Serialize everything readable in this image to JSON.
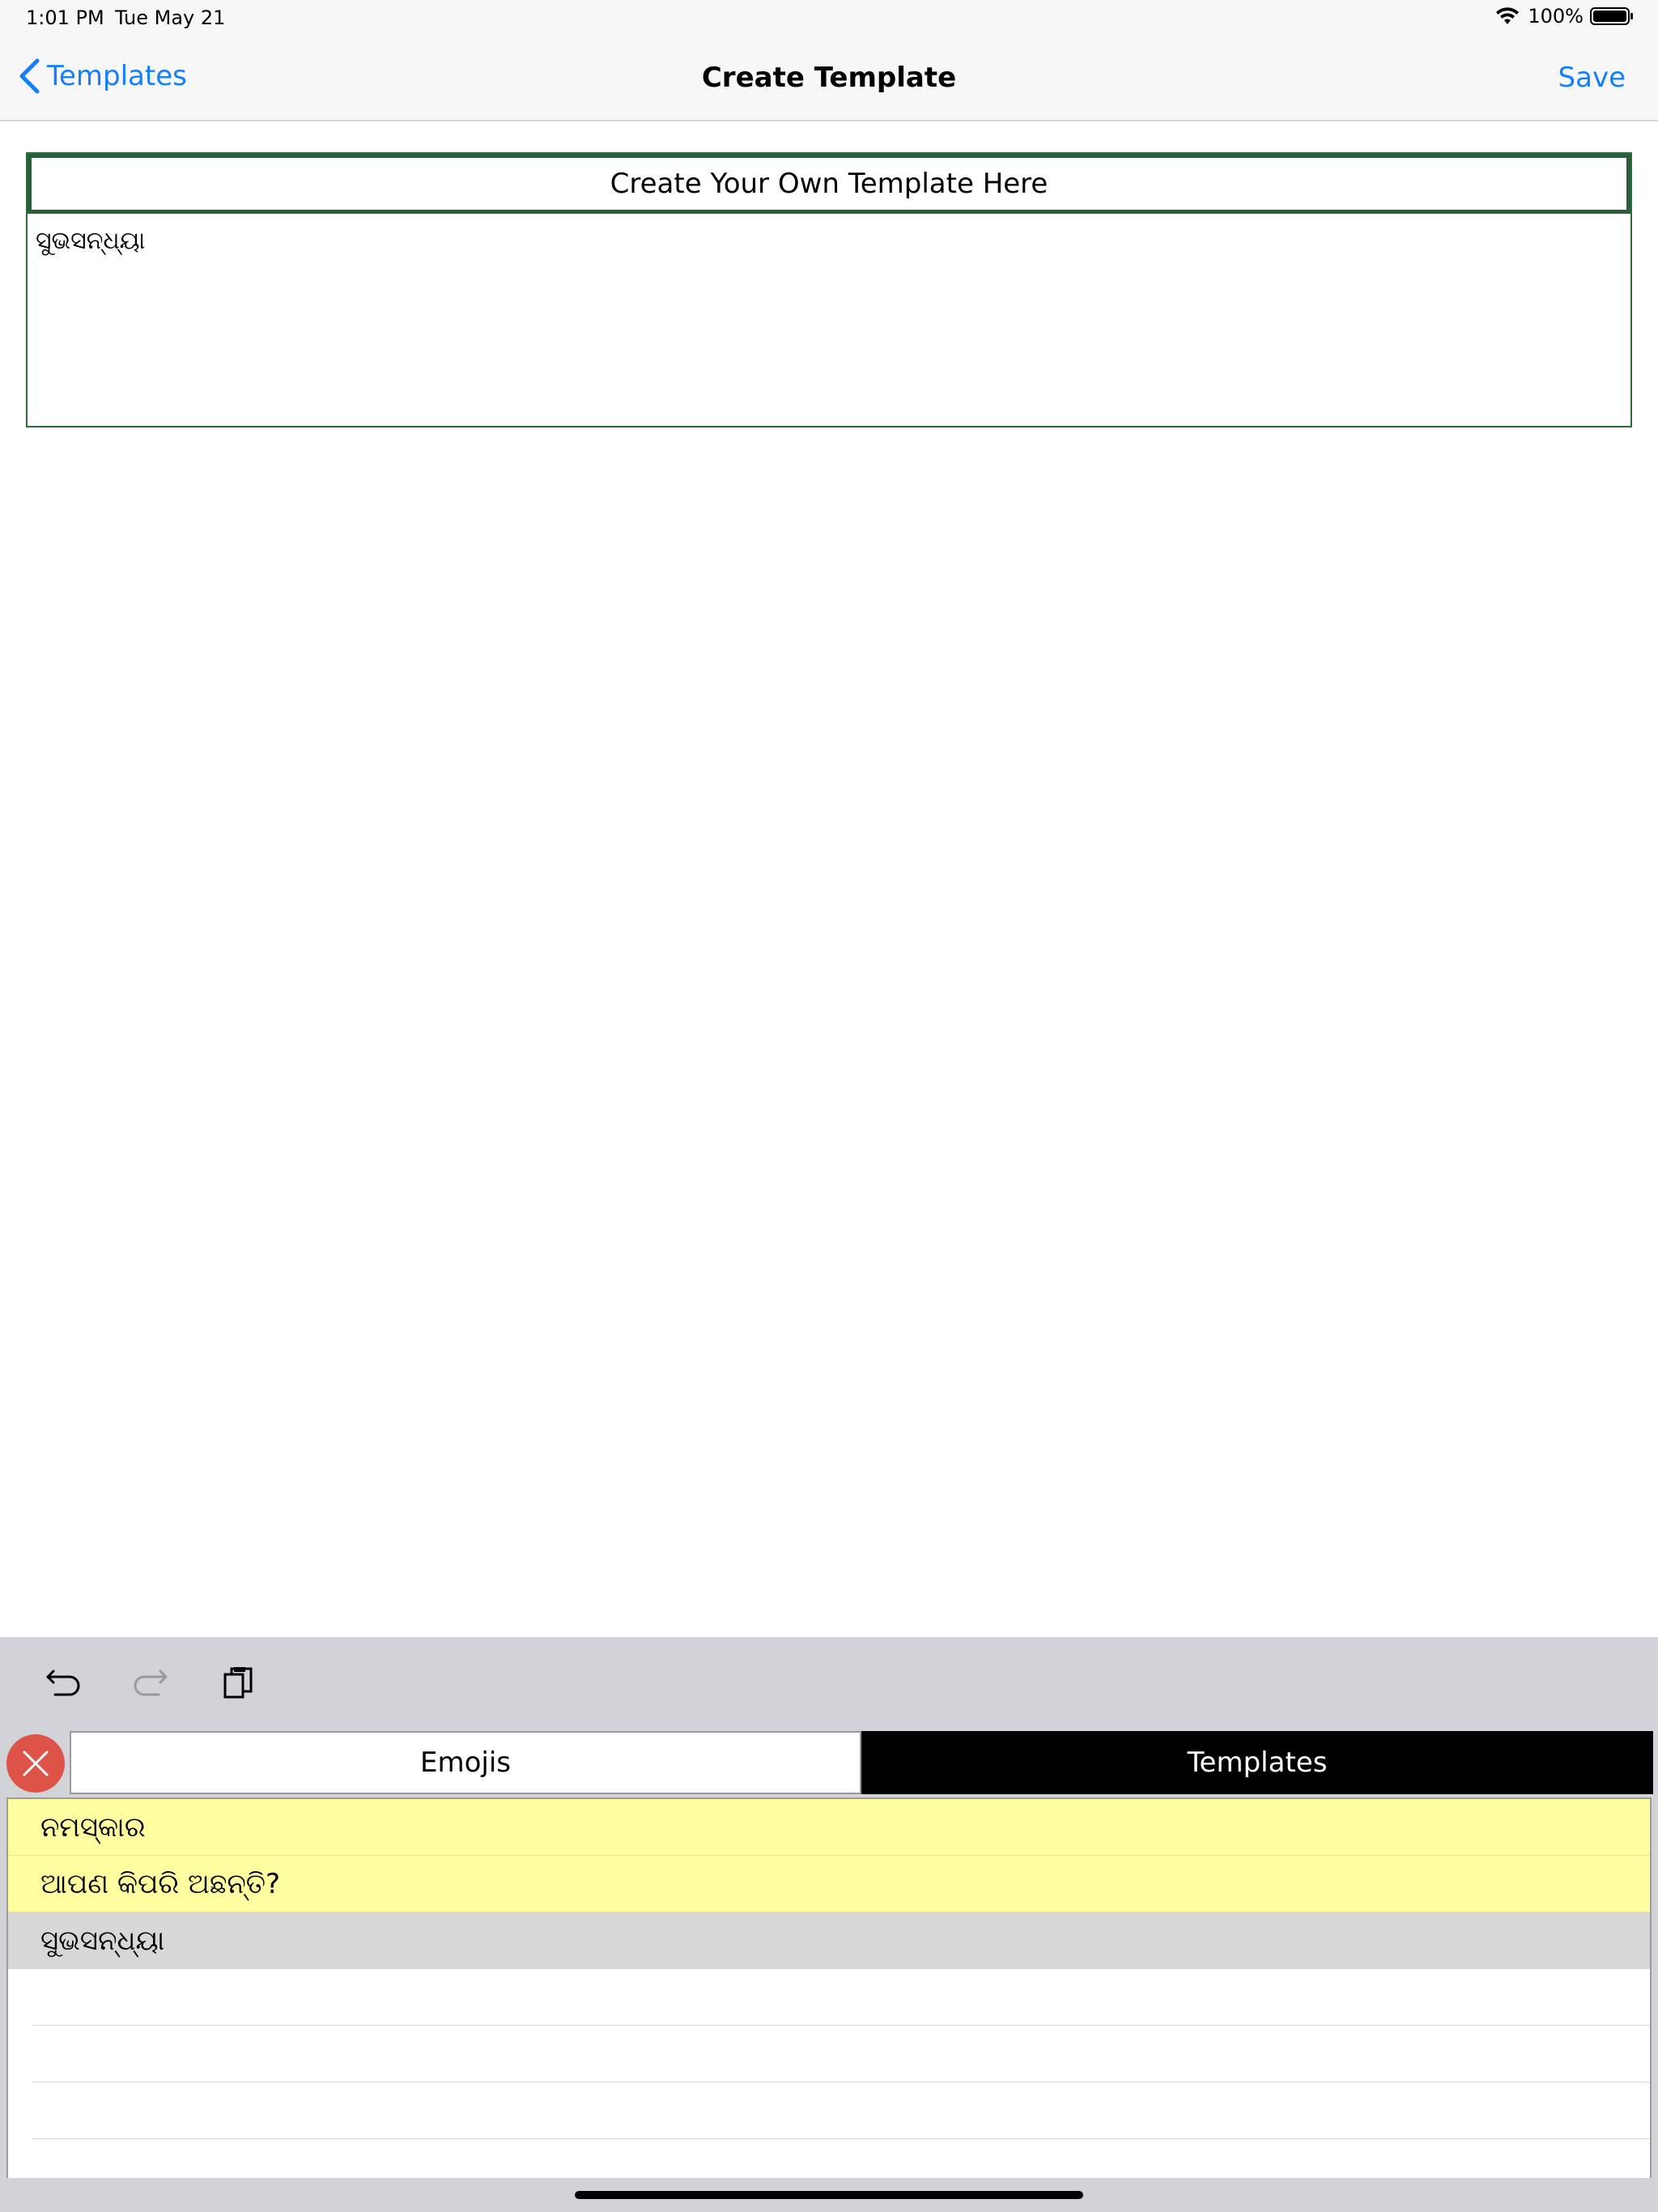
{
  "status_bar": {
    "time": "1:01 PM",
    "date": "Tue May 21",
    "battery": "100%"
  },
  "nav": {
    "back_label": "Templates",
    "title": "Create Template",
    "save_label": "Save"
  },
  "editor": {
    "header": "Create Your Own Template Here",
    "text": "ସୁଭସନ୍ଧ୍ୟା"
  },
  "toolbar": {
    "undo_icon": "undo-icon",
    "redo_icon": "redo-icon",
    "paste_icon": "paste-icon"
  },
  "keyboard": {
    "tabs": [
      {
        "label": "Emojis",
        "selected": false
      },
      {
        "label": "Templates",
        "selected": true
      }
    ],
    "templates": [
      {
        "text": "ନମସ୍କାର",
        "state": "highlighted"
      },
      {
        "text": "ଆପଣ କିପରି ଅଛନ୍ତି?",
        "state": "highlighted"
      },
      {
        "text": "ସୁଭସନ୍ଧ୍ୟା",
        "state": "selected"
      }
    ],
    "empty_rows": 3
  },
  "colors": {
    "accent": "#147efb",
    "editor_border": "#2a5e38",
    "highlight": "#fefd9f",
    "selected": "#d7d7d7",
    "close_button": "#de5347"
  }
}
